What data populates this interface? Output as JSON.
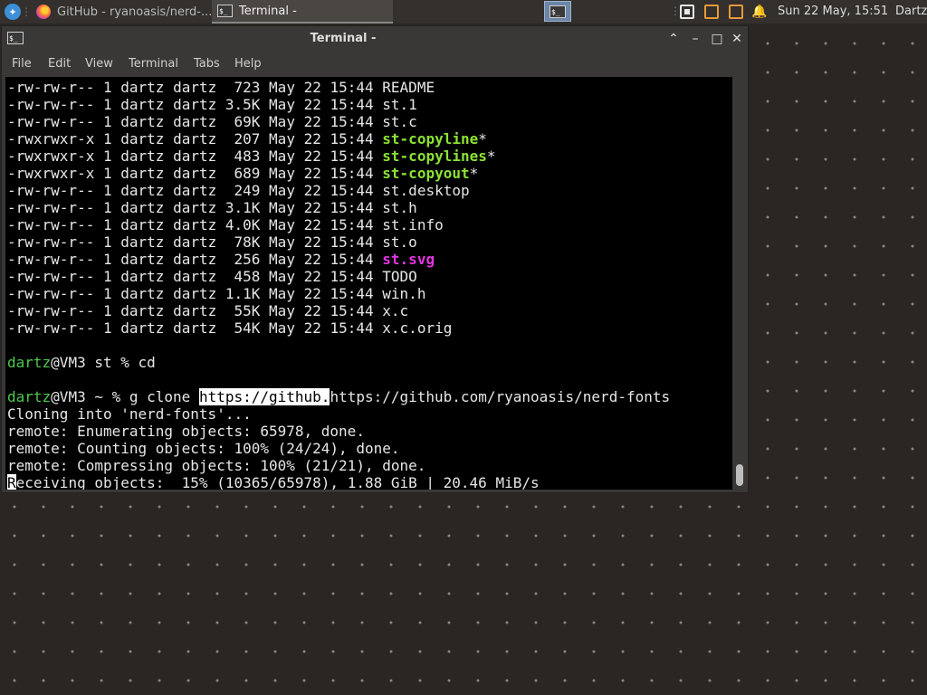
{
  "panel": {
    "tasks": [
      {
        "label": "GitHub - ryanoasis/nerd-...",
        "icon": "firefox-icon"
      },
      {
        "label": "Terminal -",
        "icon": "terminal-icon",
        "active": true
      }
    ],
    "clock": "Sun 22 May, 15:51",
    "user": "Dartz"
  },
  "window": {
    "title": "Terminal -",
    "menu": [
      "File",
      "Edit",
      "View",
      "Terminal",
      "Tabs",
      "Help"
    ]
  },
  "terminal": {
    "listing": [
      {
        "perm": "-rw-rw-r--",
        "links": "1",
        "owner": "dartz",
        "group": "dartz",
        "size": " 723",
        "date": "May 22 15:44",
        "name": "README",
        "kind": "file"
      },
      {
        "perm": "-rw-rw-r--",
        "links": "1",
        "owner": "dartz",
        "group": "dartz",
        "size": "3.5K",
        "date": "May 22 15:44",
        "name": "st.1",
        "kind": "file"
      },
      {
        "perm": "-rw-rw-r--",
        "links": "1",
        "owner": "dartz",
        "group": "dartz",
        "size": " 69K",
        "date": "May 22 15:44",
        "name": "st.c",
        "kind": "file"
      },
      {
        "perm": "-rwxrwxr-x",
        "links": "1",
        "owner": "dartz",
        "group": "dartz",
        "size": " 207",
        "date": "May 22 15:44",
        "name": "st-copyline",
        "suffix": "*",
        "kind": "exec"
      },
      {
        "perm": "-rwxrwxr-x",
        "links": "1",
        "owner": "dartz",
        "group": "dartz",
        "size": " 483",
        "date": "May 22 15:44",
        "name": "st-copylines",
        "suffix": "*",
        "kind": "exec"
      },
      {
        "perm": "-rwxrwxr-x",
        "links": "1",
        "owner": "dartz",
        "group": "dartz",
        "size": " 689",
        "date": "May 22 15:44",
        "name": "st-copyout",
        "suffix": "*",
        "kind": "exec"
      },
      {
        "perm": "-rw-rw-r--",
        "links": "1",
        "owner": "dartz",
        "group": "dartz",
        "size": " 249",
        "date": "May 22 15:44",
        "name": "st.desktop",
        "kind": "file"
      },
      {
        "perm": "-rw-rw-r--",
        "links": "1",
        "owner": "dartz",
        "group": "dartz",
        "size": "3.1K",
        "date": "May 22 15:44",
        "name": "st.h",
        "kind": "file"
      },
      {
        "perm": "-rw-rw-r--",
        "links": "1",
        "owner": "dartz",
        "group": "dartz",
        "size": "4.0K",
        "date": "May 22 15:44",
        "name": "st.info",
        "kind": "file"
      },
      {
        "perm": "-rw-rw-r--",
        "links": "1",
        "owner": "dartz",
        "group": "dartz",
        "size": " 78K",
        "date": "May 22 15:44",
        "name": "st.o",
        "kind": "file"
      },
      {
        "perm": "-rw-rw-r--",
        "links": "1",
        "owner": "dartz",
        "group": "dartz",
        "size": " 256",
        "date": "May 22 15:44",
        "name": "st.svg",
        "kind": "image"
      },
      {
        "perm": "-rw-rw-r--",
        "links": "1",
        "owner": "dartz",
        "group": "dartz",
        "size": " 458",
        "date": "May 22 15:44",
        "name": "TODO",
        "kind": "file"
      },
      {
        "perm": "-rw-rw-r--",
        "links": "1",
        "owner": "dartz",
        "group": "dartz",
        "size": "1.1K",
        "date": "May 22 15:44",
        "name": "win.h",
        "kind": "file"
      },
      {
        "perm": "-rw-rw-r--",
        "links": "1",
        "owner": "dartz",
        "group": "dartz",
        "size": " 55K",
        "date": "May 22 15:44",
        "name": "x.c",
        "kind": "file"
      },
      {
        "perm": "-rw-rw-r--",
        "links": "1",
        "owner": "dartz",
        "group": "dartz",
        "size": " 54K",
        "date": "May 22 15:44",
        "name": "x.c.orig",
        "kind": "file"
      }
    ],
    "prompt1": {
      "user": "dartz",
      "rest": "@VM3 st % ",
      "cmd": "cd"
    },
    "prompt2": {
      "user": "dartz",
      "rest": "@VM3 ~ % ",
      "cmd": "g clone ",
      "selected": "https://github.",
      "tail": "https://github.com/ryanoasis/nerd-fonts"
    },
    "output": [
      "Cloning into 'nerd-fonts'...",
      "remote: Enumerating objects: 65978, done.",
      "remote: Counting objects: 100% (24/24), done.",
      "remote: Compressing objects: 100% (21/21), done."
    ],
    "progress": {
      "cursor_char": "R",
      "rest": "eceiving objects:  15% (10365/65978), 1.88 GiB | 20.46 MiB/s"
    }
  },
  "colors": {
    "exec": "#8ae234",
    "image": "#e535e3",
    "prompt_user": "#4ec94e"
  }
}
